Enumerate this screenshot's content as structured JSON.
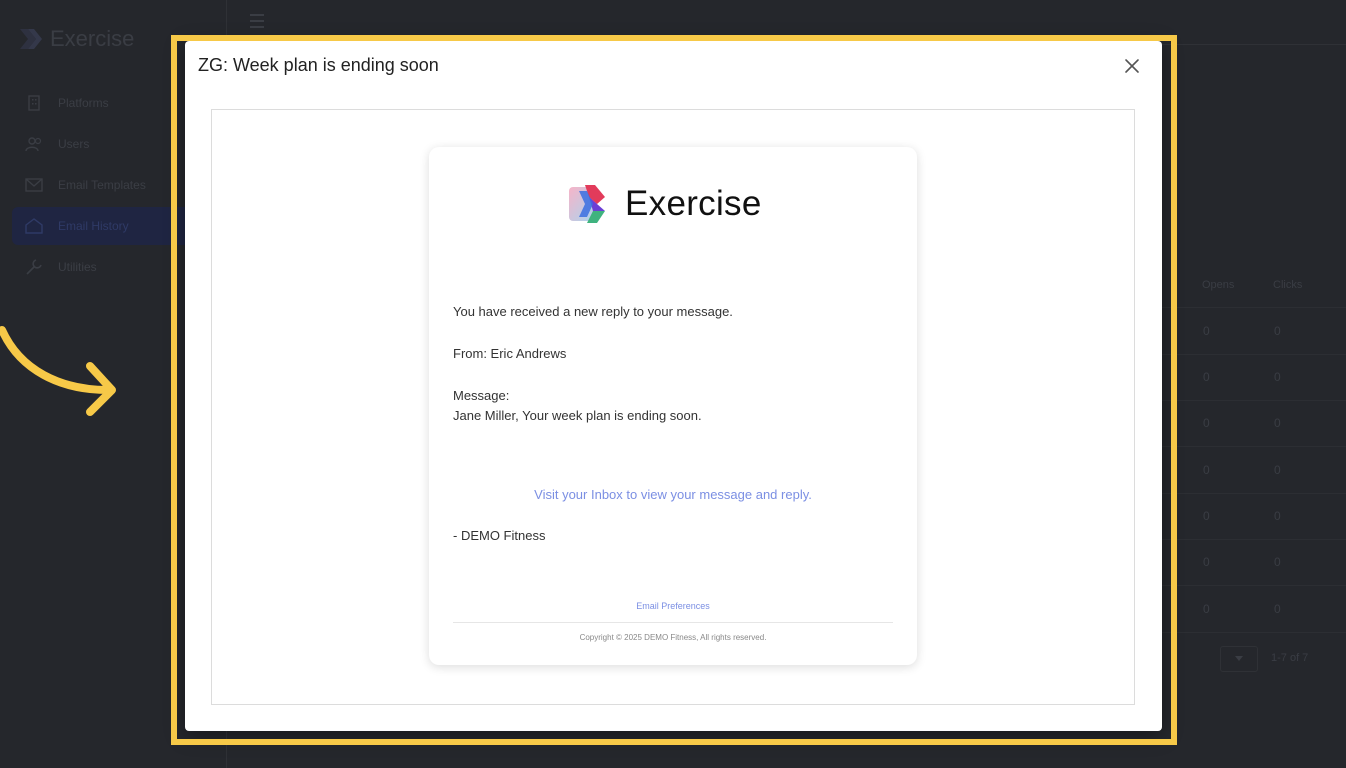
{
  "app": {
    "brand": "Exercise",
    "nav": [
      {
        "label": "Platforms",
        "icon": "building-icon"
      },
      {
        "label": "Users",
        "icon": "users-icon"
      },
      {
        "label": "Email Templates",
        "icon": "envelope-icon"
      },
      {
        "label": "Email History",
        "icon": "inbox-icon",
        "active": true
      },
      {
        "label": "Utilities",
        "icon": "wrench-icon"
      }
    ],
    "table": {
      "headers": [
        "Opens",
        "Clicks"
      ],
      "rows": [
        [
          "0",
          "0"
        ],
        [
          "0",
          "0"
        ],
        [
          "0",
          "0"
        ],
        [
          "0",
          "0"
        ],
        [
          "0",
          "0"
        ],
        [
          "0",
          "0"
        ],
        [
          "0",
          "0"
        ]
      ]
    },
    "pager": "1-7 of 7"
  },
  "modal": {
    "title": "ZG: Week plan is ending soon",
    "close_label": "×"
  },
  "email": {
    "brand": "Exercise",
    "line1": "You have received a new reply to your message.",
    "from": "From: Eric Andrews",
    "message_label": "Message:",
    "message_body": "Jane Miller, Your week plan is ending soon.",
    "link": "Visit your Inbox to view your message and reply.",
    "signature": "- DEMO Fitness",
    "preferences": "Email Preferences",
    "copyright": "Copyright © 2025 DEMO Fitness, All rights reserved."
  },
  "colors": {
    "highlight": "#f7c948",
    "link": "#7b8fe3",
    "background": "#25272c"
  }
}
